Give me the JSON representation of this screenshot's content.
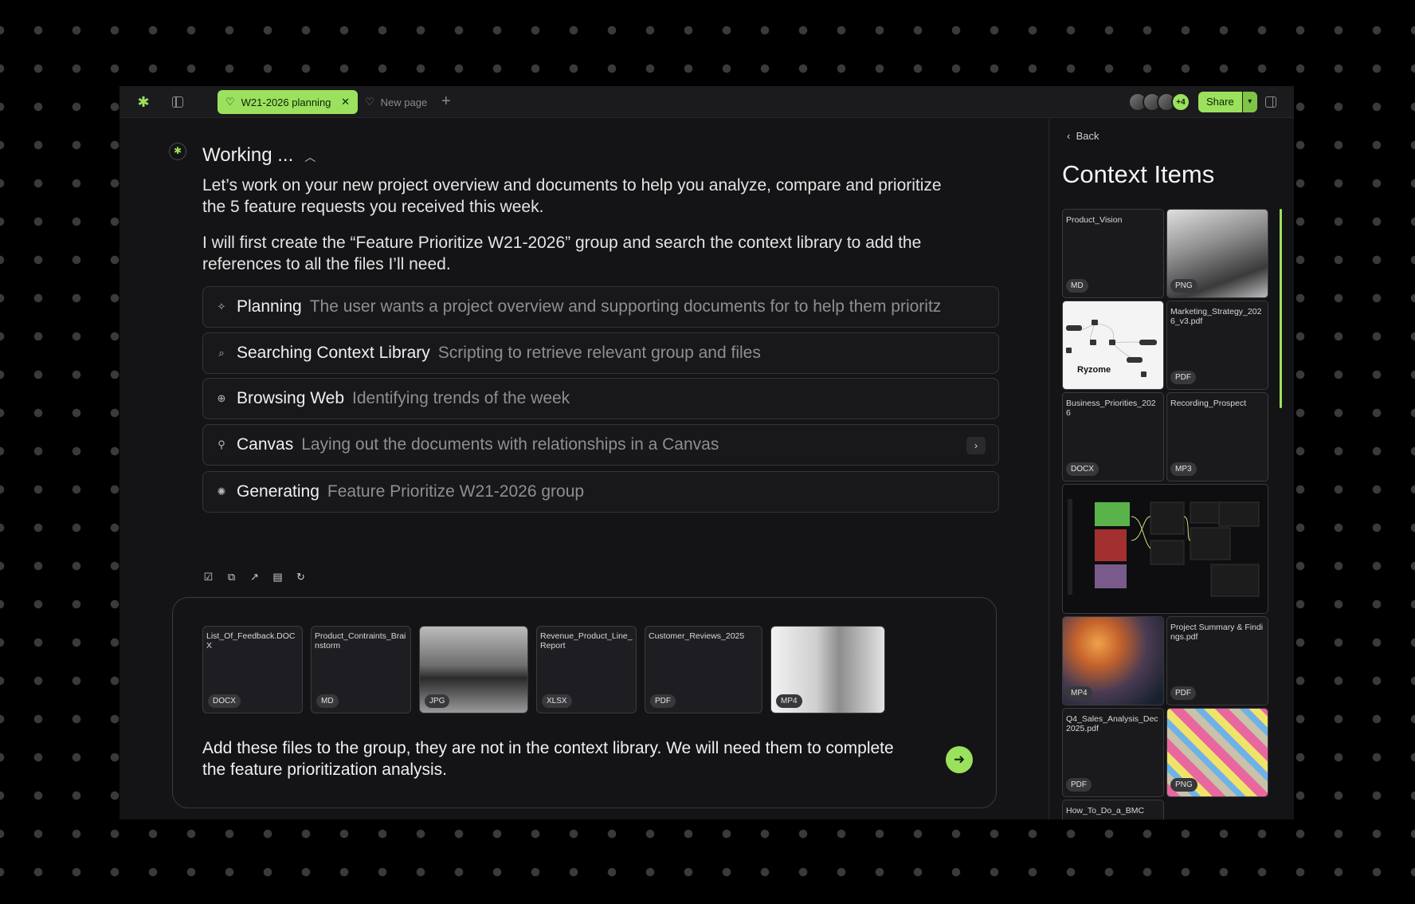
{
  "topbar": {
    "tab_active": "W21-2026 planning",
    "tab_new": "New page",
    "avatars_more": "+4",
    "share_label": "Share"
  },
  "main": {
    "status": "Working ...",
    "para1": "Let’s work on your new project overview and documents to help you analyze, compare and prioritize the 5 feature requests you received this week.",
    "para2": "I will first create the “Feature Prioritize W21-2026” group and search the context library to add the  references to all the files I’ll need.",
    "steps": [
      {
        "title": "Planning",
        "sub": "The user wants a project overview and supporting documents for to help them prioritz",
        "icon": "sparkle-icon"
      },
      {
        "title": "Searching Context Library",
        "sub": "Scripting to retrieve relevant group and files",
        "icon": "search-icon"
      },
      {
        "title": "Browsing Web",
        "sub": "Identifying trends of the week",
        "icon": "globe-icon"
      },
      {
        "title": "Canvas",
        "sub": "Laying out the documents with relationships in a Canvas",
        "icon": "canvas-icon"
      },
      {
        "title": "Generating",
        "sub": "Feature Prioritize W21-2026 group",
        "icon": "brain-icon"
      }
    ]
  },
  "composer": {
    "files": [
      {
        "name": "List_Of_Feedback.DOCX",
        "type": "DOCX"
      },
      {
        "name": "Product_Contraints_Brainstorm",
        "type": "MD"
      },
      {
        "name": "",
        "type": "JPG"
      },
      {
        "name": "Revenue_Product_Line_Report",
        "type": "XLSX"
      },
      {
        "name": "Customer_Reviews_2025",
        "type": "PDF"
      },
      {
        "name": "",
        "type": "MP4"
      }
    ],
    "prompt": "Add these files to the group, they are not in the context library. We will need them to complete the feature prioritization analysis."
  },
  "sidebar": {
    "back_label": "Back",
    "title": "Context Items",
    "graph_label": "Ryzome",
    "items": [
      {
        "name": "Product_Vision",
        "type": "MD"
      },
      {
        "name": "",
        "type": "PNG"
      },
      {
        "name": "Marketing_Strategy_2026_v3.pdf",
        "type": "PDF"
      },
      {
        "name": "Business_Priorities_2026",
        "type": "DOCX"
      },
      {
        "name": "Recording_Prospect",
        "type": "MP3"
      },
      {
        "name": "",
        "type": "MP4"
      },
      {
        "name": "Project Summary & Findings.pdf",
        "type": "PDF"
      },
      {
        "name": "Q4_Sales_Analysis_Dec2025.pdf",
        "type": "PDF"
      },
      {
        "name": "",
        "type": "PNG"
      },
      {
        "name": "How_To_Do_a_BMC",
        "type": ""
      }
    ]
  },
  "colors": {
    "accent": "#9be15d",
    "background": "#141416"
  }
}
